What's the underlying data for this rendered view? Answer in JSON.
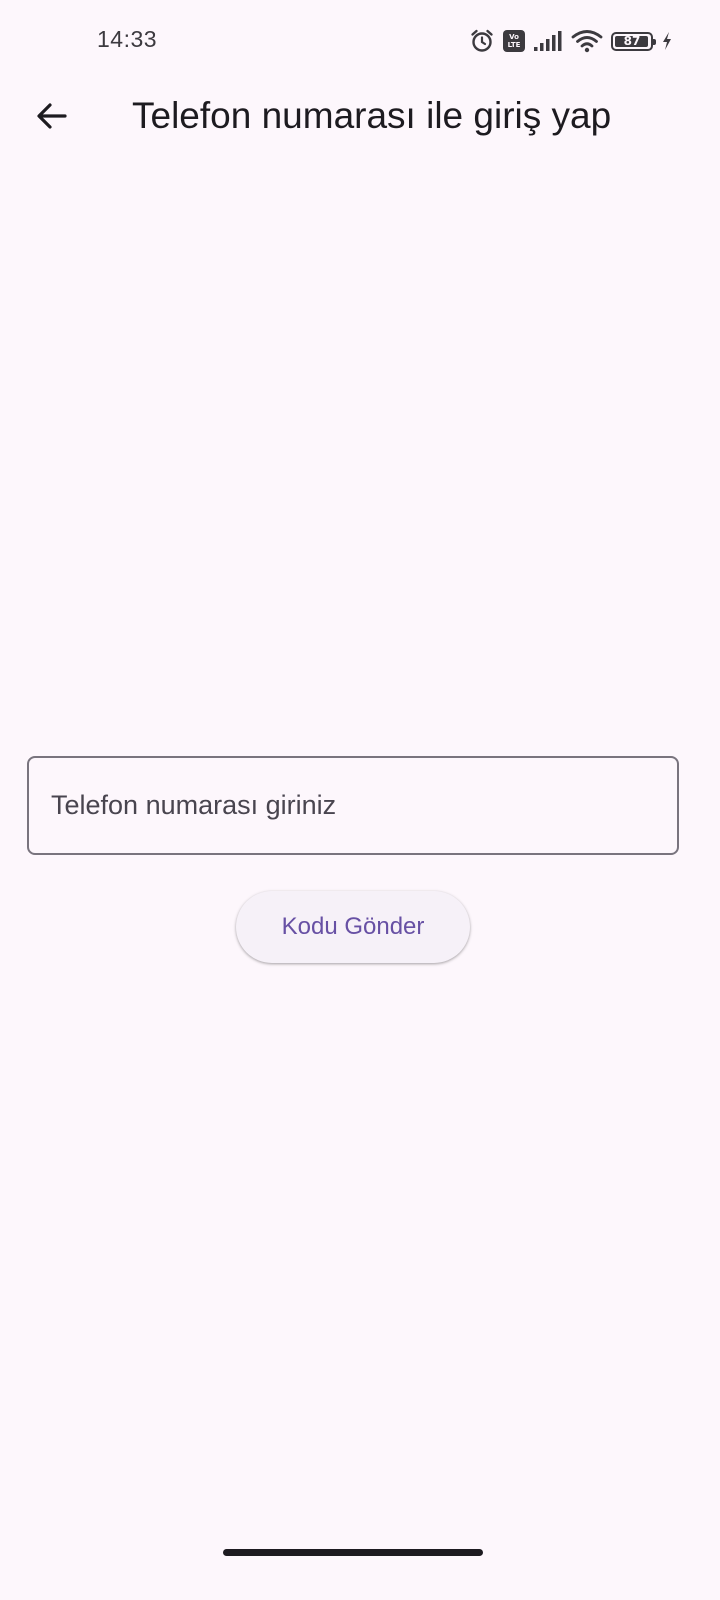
{
  "status_bar": {
    "time": "14:33",
    "volte_top": "Vo",
    "volte_bottom": "LTE",
    "battery_level": "87",
    "icons": [
      "alarm-icon",
      "volte-icon",
      "signal-icon",
      "wifi-icon",
      "battery-icon",
      "charging-icon"
    ]
  },
  "app_bar": {
    "title": "Telefon numarası ile giriş yap",
    "back_icon": "arrow-back-icon"
  },
  "form": {
    "phone_placeholder": "Telefon numarası giriniz",
    "phone_value": "",
    "send_button_label": "Kodu Gönder"
  },
  "colors": {
    "background": "#fdf7fc",
    "accent": "#6750a4",
    "outline": "#79747e",
    "text": "#1d1b20"
  }
}
